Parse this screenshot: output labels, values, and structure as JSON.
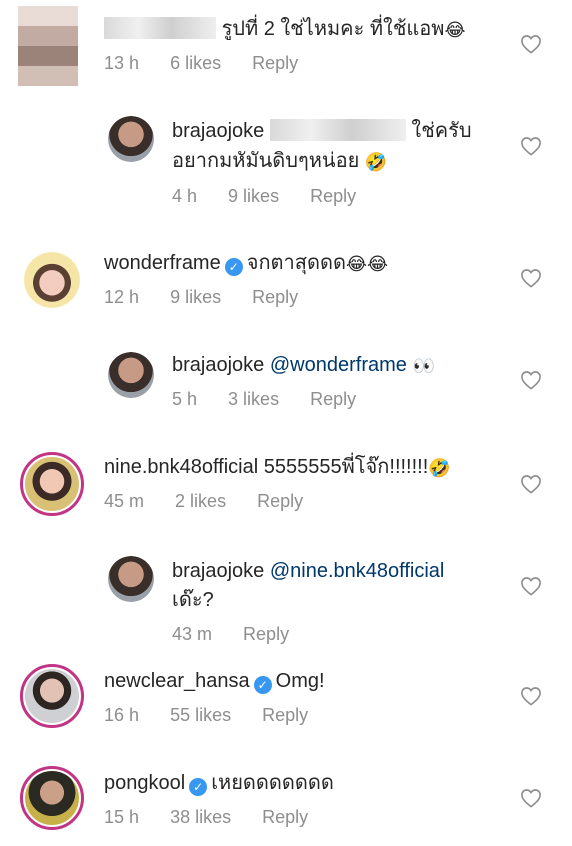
{
  "comments": [
    {
      "user": "",
      "text": "รูปที่ 2 ใช่ไหมคะ ที่ใช้แอพ",
      "emoji": "😂",
      "time": "13 h",
      "likes": "6 likes",
      "reply": "Reply"
    },
    {
      "user": "brajaojoke",
      "text": "ใช่ครับ",
      "text2": "อยากมหัมันดิบๆหน่อย",
      "emoji": "🤣",
      "time": "4 h",
      "likes": "9 likes",
      "reply": "Reply"
    },
    {
      "user": "wonderframe",
      "text": "จกตาสุดดด",
      "emoji": "😂😂",
      "time": "12 h",
      "likes": "9 likes",
      "reply": "Reply"
    },
    {
      "user": "brajaojoke",
      "mention": "@wonderframe",
      "emoji": "👀",
      "time": "5 h",
      "likes": "3 likes",
      "reply": "Reply"
    },
    {
      "user": "nine.bnk48official",
      "text": "5555555พี่โจ๊ก!!!!!!!",
      "emoji": "🤣",
      "time": "45 m",
      "likes": "2 likes",
      "reply": "Reply"
    },
    {
      "user": "brajaojoke",
      "mention": "@nine.bnk48official",
      "text2": "เด๊ะ?",
      "time": "43 m",
      "reply": "Reply"
    },
    {
      "user": "newclear_hansa",
      "text": "Omg!",
      "time": "16 h",
      "likes": "55 likes",
      "reply": "Reply"
    },
    {
      "user": "pongkool",
      "text": "เหยดดดดดดด",
      "time": "15 h",
      "likes": "38 likes",
      "reply": "Reply"
    }
  ],
  "icons": {
    "like": "heart-outline-icon",
    "verified": "verified-badge-icon"
  },
  "colors": {
    "mention": "#00376b",
    "verified": "#3897f0",
    "story_ring": "#c13584",
    "meta": "#8e8e8e"
  }
}
